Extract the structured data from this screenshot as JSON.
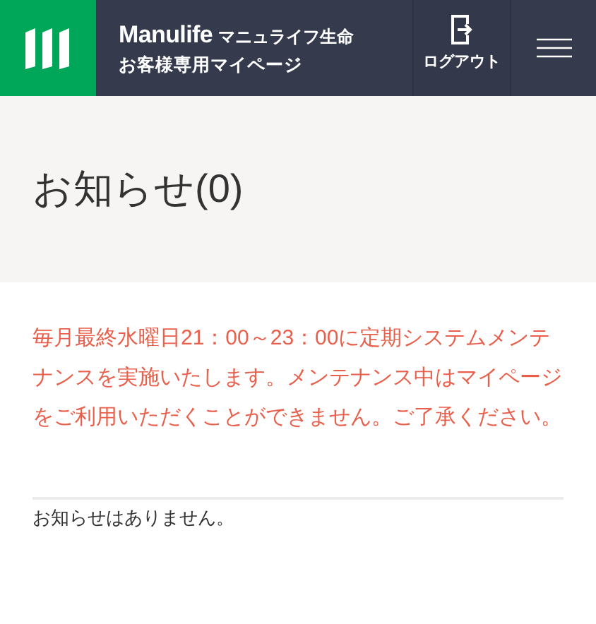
{
  "header": {
    "brand": "Manulife",
    "company": "マニュライフ生命",
    "subtitle": "お客様専用マイページ",
    "logout": "ログアウト"
  },
  "page_title": "お知らせ(0)",
  "maintenance_notice": "毎月最終水曜日21：00～23：00に定期システムメンテナンスを実施いたします。メンテナンス中はマイページをご利用いただくことができません。ご了承ください。",
  "empty_message": "お知らせはありません。"
}
